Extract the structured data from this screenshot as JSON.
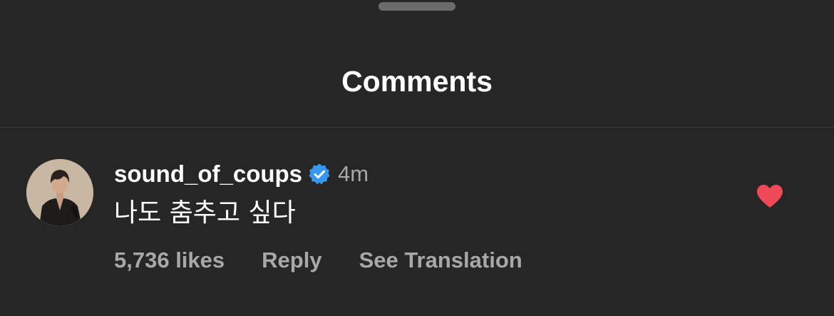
{
  "header": {
    "title": "Comments"
  },
  "comment": {
    "username": "sound_of_coups",
    "verified_icon": "verified-badge-icon",
    "timestamp": "4m",
    "text": "나도 춤추고 싶다",
    "likes": "5,736 likes",
    "reply_label": "Reply",
    "translation_label": "See Translation",
    "liked": true,
    "like_icon": "heart-filled-icon"
  },
  "colors": {
    "background": "#262626",
    "primary_text": "#ffffff",
    "secondary_text": "#a8a8a8",
    "verified_blue": "#3897f0",
    "like_red": "#ed4956"
  }
}
